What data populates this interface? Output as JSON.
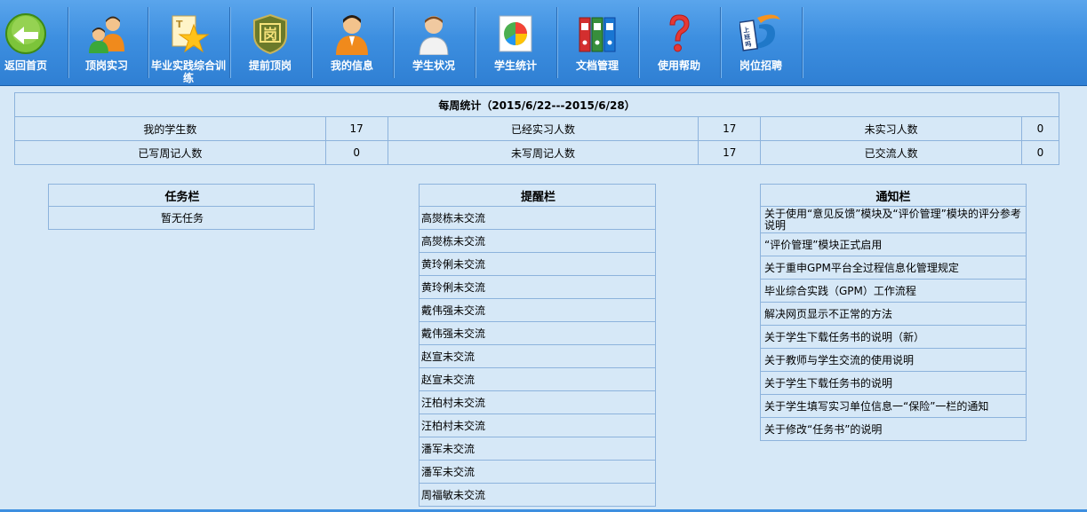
{
  "toolbar": {
    "items": [
      {
        "label": "返回首页",
        "icon": "back-arrow-icon"
      },
      {
        "label": "顶岗实习",
        "icon": "users-icon"
      },
      {
        "label": "毕业实践综合训练",
        "icon": "star-document-icon"
      },
      {
        "label": "提前顶岗",
        "icon": "shield-badge-icon"
      },
      {
        "label": "我的信息",
        "icon": "user-orange-icon"
      },
      {
        "label": "学生状况",
        "icon": "student-icon"
      },
      {
        "label": "学生统计",
        "icon": "pie-chart-icon"
      },
      {
        "label": "文档管理",
        "icon": "binders-icon"
      },
      {
        "label": "使用帮助",
        "icon": "question-icon"
      },
      {
        "label": "岗位招聘",
        "icon": "recruit-logo-icon"
      }
    ]
  },
  "weekly": {
    "title": "每周统计（2015/6/22---2015/6/28）",
    "rows": [
      [
        {
          "label": "我的学生数",
          "value": "17"
        },
        {
          "label": "已经实习人数",
          "value": "17"
        },
        {
          "label": "未实习人数",
          "value": "0"
        }
      ],
      [
        {
          "label": "已写周记人数",
          "value": "0"
        },
        {
          "label": "未写周记人数",
          "value": "17"
        },
        {
          "label": "已交流人数",
          "value": "0"
        }
      ]
    ]
  },
  "tasks": {
    "title": "任务栏",
    "empty": "暂无任务"
  },
  "reminders": {
    "title": "提醒栏",
    "items": [
      "高爕栋未交流",
      "高爕栋未交流",
      "黄玲俐未交流",
      "黄玲俐未交流",
      "戴伟强未交流",
      "戴伟强未交流",
      "赵宣未交流",
      "赵宣未交流",
      "汪柏村未交流",
      "汪柏村未交流",
      "潘军未交流",
      "潘军未交流",
      "周福敏未交流"
    ]
  },
  "notices": {
    "title": "通知栏",
    "items": [
      "关于使用“意见反馈”模块及“评价管理”模块的评分参考说明",
      "“评价管理”模块正式启用",
      "关于重申GPM平台全过程信息化管理规定",
      "毕业综合实践（GPM）工作流程",
      "解决网页显示不正常的方法",
      "关于学生下载任务书的说明（新）",
      "关于教师与学生交流的使用说明",
      "关于学生下载任务书的说明",
      "关于学生填写实习单位信息一“保险”一栏的通知",
      "关于修改“任务书”的说明"
    ]
  },
  "colors": {
    "toolbar": "#3d8fe0",
    "border": "#8db3dc",
    "background": "#d6e8f7"
  }
}
